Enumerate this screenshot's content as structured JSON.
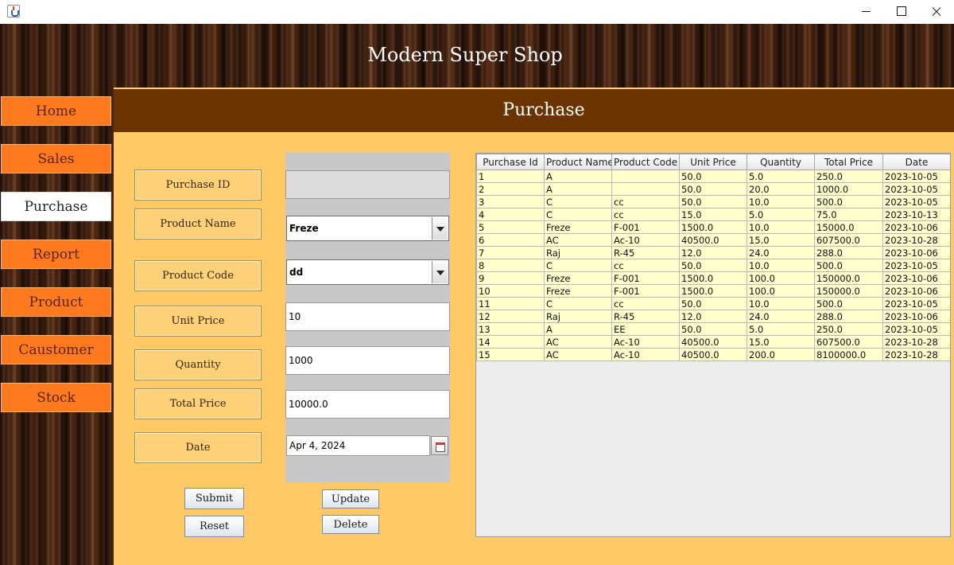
{
  "app": {
    "title": "Modern Super Shop"
  },
  "page": {
    "title": "Purchase"
  },
  "nav": [
    {
      "label": "Home"
    },
    {
      "label": "Sales"
    },
    {
      "label": "Purchase",
      "active": true
    },
    {
      "label": "Report"
    },
    {
      "label": "Product"
    },
    {
      "label": "Caustomer"
    },
    {
      "label": "Stock"
    }
  ],
  "form": {
    "labels": {
      "purchase_id": "Purchase ID",
      "product_name": "Product Name",
      "product_code": "Product Code",
      "unit_price": "Unit Price",
      "quantity": "Quantity",
      "total_price": "Total Price",
      "date": "Date"
    },
    "values": {
      "purchase_id": "",
      "product_name": "Freze",
      "product_code": "dd",
      "unit_price": "10",
      "quantity": "1000",
      "total_price": "10000.0",
      "date": "Apr 4, 2024"
    }
  },
  "buttons": {
    "submit": "Submit",
    "reset": "Reset",
    "update": "Update",
    "delete": "Delete"
  },
  "table": {
    "columns": [
      "Purchase Id",
      "Product Name",
      "Product Code",
      "Unit Price",
      "Quantity",
      "Total Price",
      "Date"
    ],
    "rows": [
      [
        "1",
        "A",
        "",
        "50.0",
        "5.0",
        "250.0",
        "2023-10-05"
      ],
      [
        "2",
        "A",
        "",
        "50.0",
        "20.0",
        "1000.0",
        "2023-10-05"
      ],
      [
        "3",
        "C",
        "cc",
        "50.0",
        "10.0",
        "500.0",
        "2023-10-05"
      ],
      [
        "4",
        "C",
        "cc",
        "15.0",
        "5.0",
        "75.0",
        "2023-10-13"
      ],
      [
        "5",
        "Freze",
        "F-001",
        "1500.0",
        "10.0",
        "15000.0",
        "2023-10-06"
      ],
      [
        "6",
        "AC",
        "Ac-10",
        "40500.0",
        "15.0",
        "607500.0",
        "2023-10-28"
      ],
      [
        "7",
        "Raj",
        "R-45",
        "12.0",
        "24.0",
        "288.0",
        "2023-10-06"
      ],
      [
        "8",
        "C",
        "cc",
        "50.0",
        "10.0",
        "500.0",
        "2023-10-05"
      ],
      [
        "9",
        "Freze",
        "F-001",
        "1500.0",
        "100.0",
        "150000.0",
        "2023-10-06"
      ],
      [
        "10",
        "Freze",
        "F-001",
        "1500.0",
        "100.0",
        "150000.0",
        "2023-10-06"
      ],
      [
        "11",
        "C",
        "cc",
        "50.0",
        "10.0",
        "500.0",
        "2023-10-05"
      ],
      [
        "12",
        "Raj",
        "R-45",
        "12.0",
        "24.0",
        "288.0",
        "2023-10-06"
      ],
      [
        "13",
        "A",
        "EE",
        "50.0",
        "5.0",
        "250.0",
        "2023-10-05"
      ],
      [
        "14",
        "AC",
        "Ac-10",
        "40500.0",
        "15.0",
        "607500.0",
        "2023-10-28"
      ],
      [
        "15",
        "AC",
        "Ac-10",
        "40500.0",
        "200.0",
        "8100000.0",
        "2023-10-28"
      ]
    ]
  },
  "colors": {
    "nav_button": "#ff7a1f",
    "nav_active": "#ffffff",
    "page_header": "#6b3300",
    "content_bg": "#ffc966",
    "label_button": "#ffd27a",
    "table_row": "#ffffcc"
  }
}
